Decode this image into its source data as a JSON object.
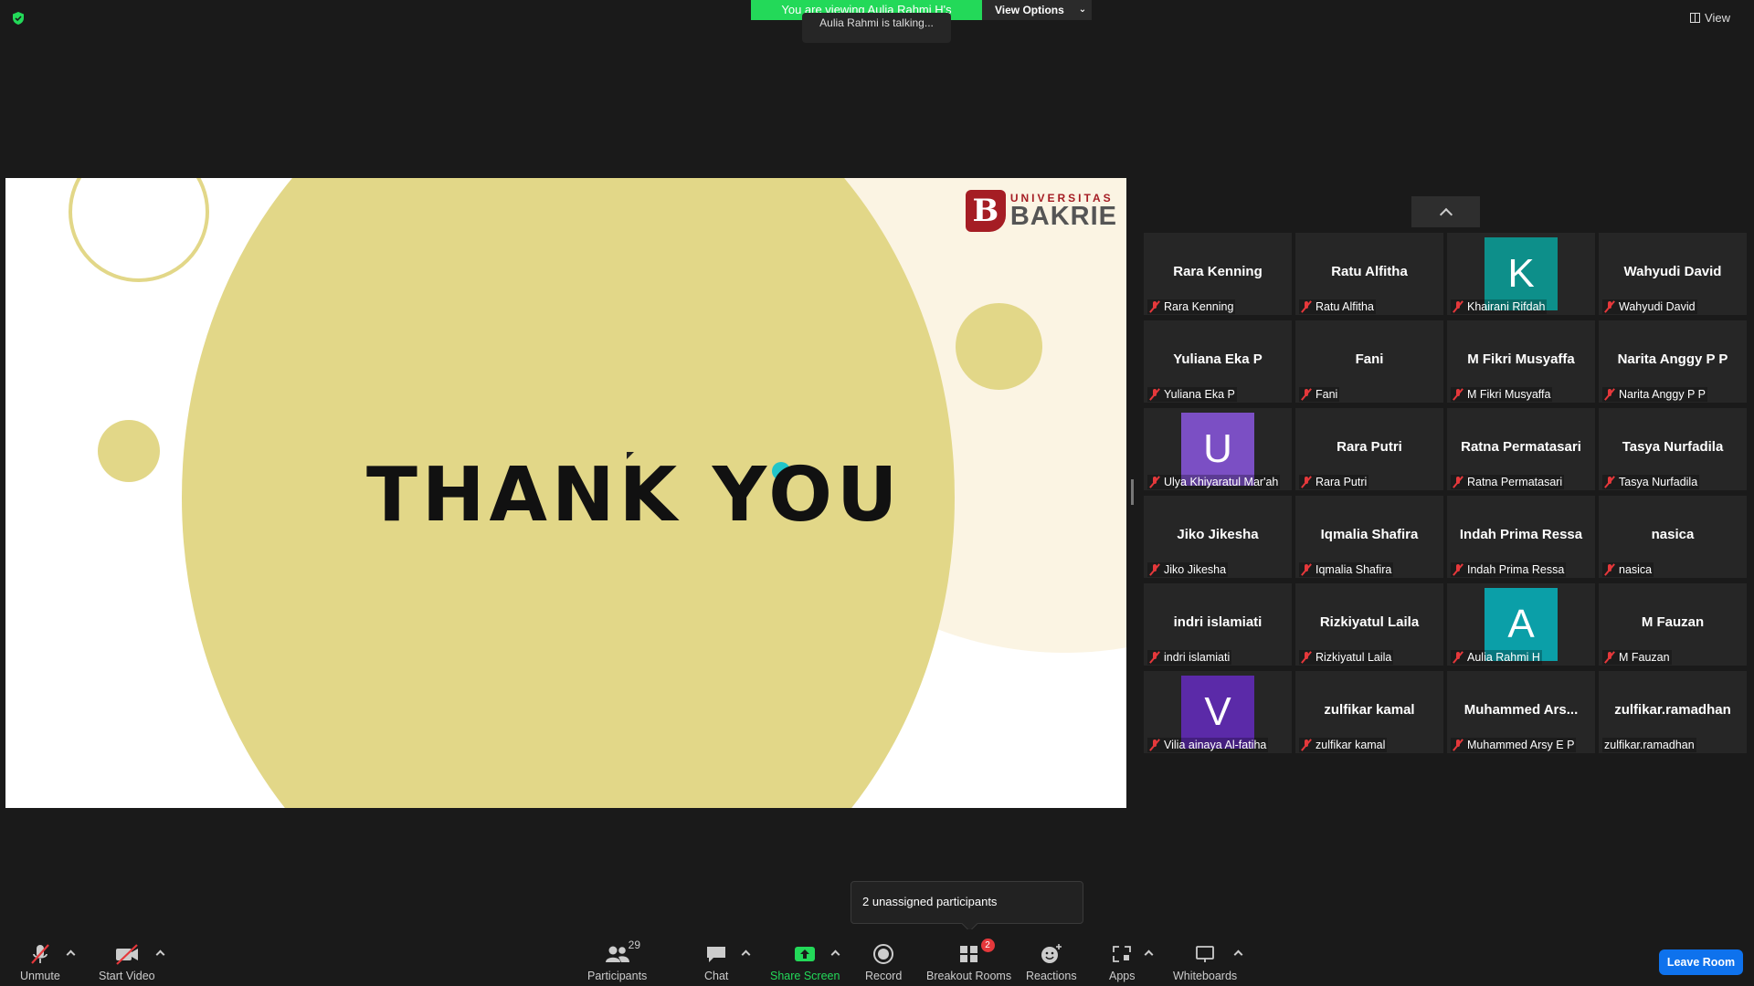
{
  "top": {
    "viewing_text": "You are viewing Aulia Rahmi H's screen",
    "view_options_label": "View Options",
    "talking_text": "Aulia Rahmi is talking...",
    "view_label": "View"
  },
  "slide": {
    "title": "THANK YOU",
    "logo_top": "UNIVERSITAS",
    "logo_name": "BAKRIE",
    "logo_mark": "B"
  },
  "colors": {
    "share_green": "#23d959",
    "muted_red": "#e5383b",
    "leave_blue": "#0e72ed",
    "slide_yellow": "#e2d788",
    "accent_teal": "#22c5c9"
  },
  "participants": [
    {
      "display": "Rara Kenning",
      "name": "Rara Kenning",
      "muted": true
    },
    {
      "display": "Ratu Alfitha",
      "name": "Ratu Alfitha",
      "muted": true
    },
    {
      "avatar": "K",
      "avatar_color": "#0d8f8a",
      "name": "Khairani Rifdah",
      "muted": true
    },
    {
      "display": "Wahyudi David",
      "name": "Wahyudi David",
      "muted": true
    },
    {
      "display": "Yuliana Eka P",
      "name": "Yuliana Eka P",
      "muted": true
    },
    {
      "display": "Fani",
      "name": "Fani",
      "muted": true
    },
    {
      "display": "M Fikri Musyaffa",
      "name": "M Fikri Musyaffa",
      "muted": true
    },
    {
      "display": "Narita Anggy P P",
      "name": "Narita Anggy P P",
      "muted": true
    },
    {
      "avatar": "U",
      "avatar_color": "#7b4fc4",
      "name": "Ulya Khiyaratul Mar'ah",
      "muted": true
    },
    {
      "display": "Rara Putri",
      "name": "Rara Putri",
      "muted": true
    },
    {
      "display": "Ratna Permatasari",
      "name": "Ratna Permatasari",
      "muted": true
    },
    {
      "display": "Tasya Nurfadila",
      "name": "Tasya Nurfadila",
      "muted": true
    },
    {
      "display": "Jiko Jikesha",
      "name": "Jiko Jikesha",
      "muted": true
    },
    {
      "display": "Iqmalia Shafira",
      "name": "Iqmalia Shafira",
      "muted": true
    },
    {
      "display": "Indah Prima Ressa",
      "name": "Indah Prima Ressa",
      "muted": true
    },
    {
      "display": "nasica",
      "name": "nasica",
      "muted": true
    },
    {
      "display": "indri islamiati",
      "name": "indri islamiati",
      "muted": true
    },
    {
      "display": "Rizkiyatul Laila",
      "name": "Rizkiyatul Laila",
      "muted": true
    },
    {
      "avatar": "A",
      "avatar_color": "#0b9fa8",
      "name": "Aulia Rahmi H",
      "muted": true
    },
    {
      "display": "M Fauzan",
      "name": "M Fauzan",
      "muted": true
    },
    {
      "avatar": "V",
      "avatar_color": "#5b2aa8",
      "name": "Vilia ainaya Al-fatiha",
      "muted": true
    },
    {
      "display": "zulfikar kamal",
      "name": "zulfikar kamal",
      "muted": true
    },
    {
      "display": "Muhammed  Ars...",
      "name": "Muhammed Arsy E P",
      "muted": true
    },
    {
      "display": "zulfikar.ramadhan",
      "name": "zulfikar.ramadhan",
      "muted": false
    }
  ],
  "tooltip": {
    "text": "2 unassigned participants"
  },
  "toolbar": {
    "unmute": "Unmute",
    "start_video": "Start Video",
    "participants": "Participants",
    "participants_count": "29",
    "chat": "Chat",
    "share_screen": "Share Screen",
    "record": "Record",
    "breakout_rooms": "Breakout Rooms",
    "breakout_badge": "2",
    "reactions": "Reactions",
    "apps": "Apps",
    "whiteboards": "Whiteboards",
    "leave_room": "Leave Room"
  }
}
